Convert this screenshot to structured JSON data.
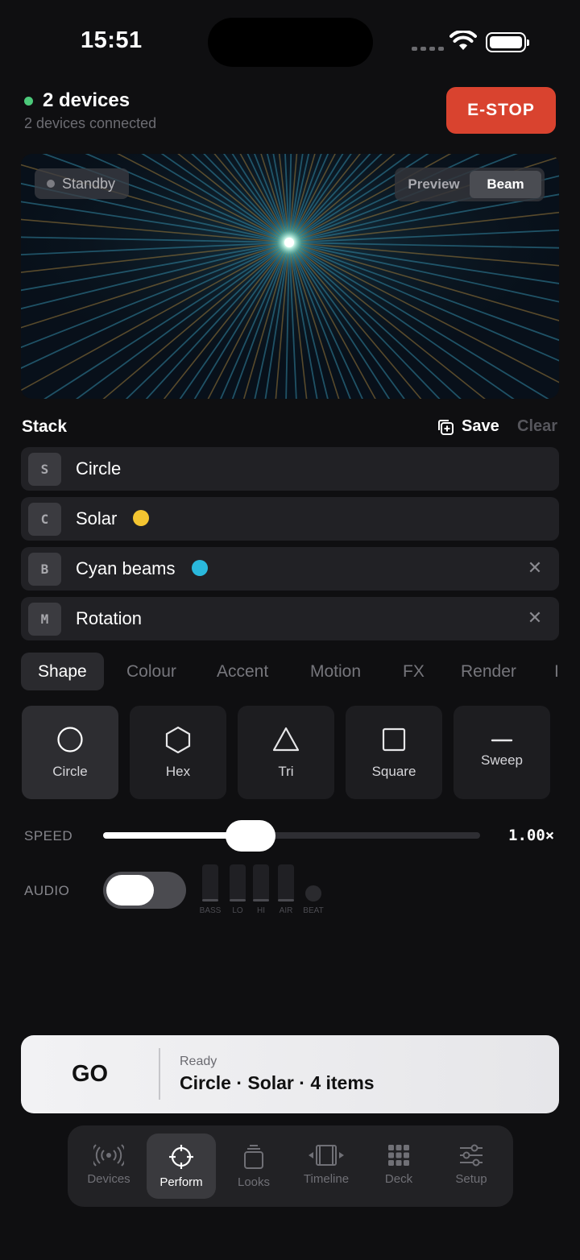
{
  "status_bar": {
    "time": "15:51"
  },
  "header": {
    "device_title": "2 devices",
    "device_subtitle": "2 devices connected",
    "estop_label": "E-STOP",
    "status_color": "#4cc97a",
    "estop_color": "#d9432f"
  },
  "preview": {
    "state_label": "Standby",
    "view_modes": [
      "Preview",
      "Beam"
    ],
    "selected_mode": "Beam"
  },
  "stack": {
    "title": "Stack",
    "save_label": "Save",
    "clear_label": "Clear",
    "items": [
      {
        "badge": "S",
        "label": "Circle",
        "swatch": null,
        "removable": false
      },
      {
        "badge": "C",
        "label": "Solar",
        "swatch": "#f4c531",
        "removable": false
      },
      {
        "badge": "B",
        "label": "Cyan beams",
        "swatch": "#2ab8dc",
        "removable": true
      },
      {
        "badge": "M",
        "label": "Rotation",
        "swatch": null,
        "removable": true
      }
    ]
  },
  "editor_tabs": {
    "items": [
      "Shape",
      "Colour",
      "Accent",
      "Motion",
      "FX",
      "Render",
      "I"
    ],
    "selected": "Shape"
  },
  "shapes": {
    "items": [
      {
        "label": "Circle",
        "icon": "circle-icon"
      },
      {
        "label": "Hex",
        "icon": "hexagon-icon"
      },
      {
        "label": "Tri",
        "icon": "triangle-icon"
      },
      {
        "label": "Square",
        "icon": "square-icon"
      },
      {
        "label": "Sweep",
        "icon": "line-icon"
      }
    ],
    "selected": "Circle"
  },
  "speed": {
    "label": "SPEED",
    "value_text": "1.00×",
    "fraction": 0.39
  },
  "audio": {
    "label": "AUDIO",
    "enabled": false,
    "bands": [
      "BASS",
      "LO",
      "HI",
      "AIR",
      "BEAT"
    ]
  },
  "go_bar": {
    "go_label": "GO",
    "status": "Ready",
    "summary": "Circle · Solar · 4 items"
  },
  "tab_bar": {
    "items": [
      {
        "label": "Devices",
        "icon": "broadcast-icon"
      },
      {
        "label": "Perform",
        "icon": "crosshair-icon"
      },
      {
        "label": "Looks",
        "icon": "stack-icon"
      },
      {
        "label": "Timeline",
        "icon": "film-icon"
      },
      {
        "label": "Deck",
        "icon": "grid-icon"
      },
      {
        "label": "Setup",
        "icon": "sliders-icon"
      }
    ],
    "selected": "Perform"
  }
}
